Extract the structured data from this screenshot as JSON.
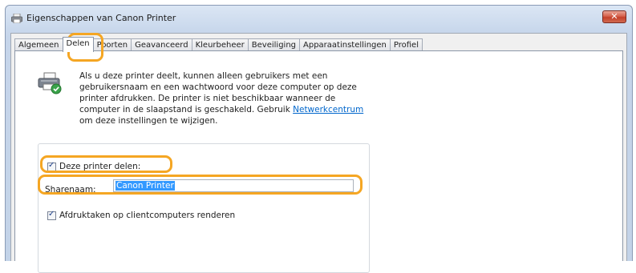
{
  "window": {
    "title": "Eigenschappen van Canon Printer",
    "close_label": "✕"
  },
  "tabs": [
    {
      "label": "Algemeen",
      "active": false
    },
    {
      "label": "Delen",
      "active": true
    },
    {
      "label": "Poorten",
      "active": false
    },
    {
      "label": "Geavanceerd",
      "active": false
    },
    {
      "label": "Kleurbeheer",
      "active": false
    },
    {
      "label": "Beveiliging",
      "active": false
    },
    {
      "label": "Apparaatinstellingen",
      "active": false
    },
    {
      "label": "Profiel",
      "active": false
    }
  ],
  "sharing": {
    "info_lines": [
      "Als u deze printer deelt, kunnen alleen gebruikers met een",
      "gebruikersnaam en een wachtwoord voor deze computer op deze",
      "printer afdrukken. De printer is niet beschikbaar wanneer de",
      "computer in de slaapstand is geschakeld. Gebruik "
    ],
    "link_text": "Netwerkcentrum",
    "info_last_line": "om deze instellingen te wijzigen.",
    "share_checkbox_label": "Deze printer delen:",
    "share_checked": true,
    "share_name_label": "Sharenaam:",
    "share_name_value": "Canon Printer",
    "render_checkbox_label": "Afdruktaken op clientcomputers renderen",
    "render_checked": true
  },
  "colors": {
    "highlight": "#f5a623",
    "link": "#0066cc",
    "selection": "#3399ff"
  }
}
